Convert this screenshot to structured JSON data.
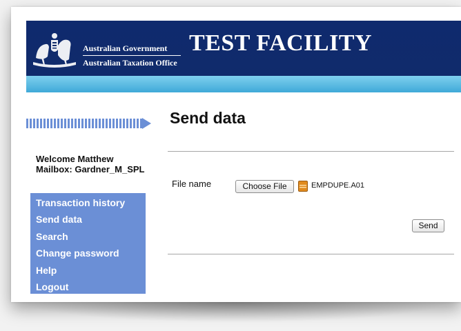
{
  "header": {
    "gov_line1": "Australian Government",
    "gov_line2": "Australian Taxation Office",
    "title": "TEST FACILITY",
    "colors": {
      "navy": "#102b6b",
      "band": "#4fb4de"
    }
  },
  "sidebar": {
    "welcome": "Welcome Matthew",
    "mailbox": "Mailbox: Gardner_M_SPL",
    "nav_color": "#6b8fd6",
    "items": [
      {
        "label": "Transaction history"
      },
      {
        "label": "Send data"
      },
      {
        "label": "Search"
      },
      {
        "label": "Change password"
      },
      {
        "label": "Help"
      },
      {
        "label": "Logout"
      }
    ]
  },
  "main": {
    "title": "Send data",
    "file_label": "File name",
    "choose_button": "Choose File",
    "selected_file": "EMPDUPE.A01",
    "send_button": "Send"
  }
}
